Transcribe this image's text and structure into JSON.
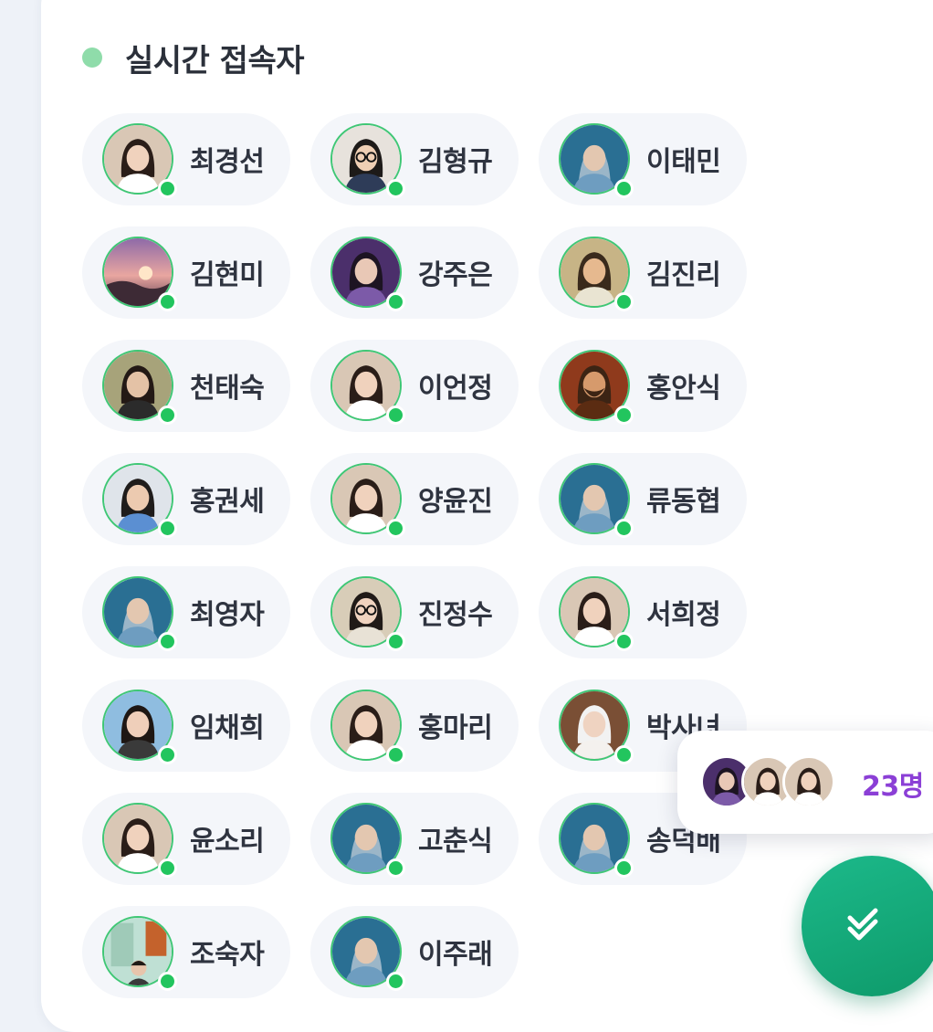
{
  "panel": {
    "title": "실시간 접속자",
    "live_indicator_color": "#8fdcaa"
  },
  "users": [
    {
      "name": "최경선",
      "online": true,
      "avatar": "woman-portrait"
    },
    {
      "name": "김형규",
      "online": true,
      "avatar": "man-glasses"
    },
    {
      "name": "이태민",
      "online": true,
      "avatar": "hooded-figure"
    },
    {
      "name": "김현미",
      "online": true,
      "avatar": "sunset-landscape"
    },
    {
      "name": "강주은",
      "online": true,
      "avatar": "woman-purple"
    },
    {
      "name": "김진리",
      "online": true,
      "avatar": "child-portrait"
    },
    {
      "name": "천태숙",
      "online": true,
      "avatar": "woman-outdoor"
    },
    {
      "name": "이언정",
      "online": true,
      "avatar": "woman-portrait"
    },
    {
      "name": "홍안식",
      "online": true,
      "avatar": "laughing-man"
    },
    {
      "name": "홍권세",
      "online": true,
      "avatar": "man-blue-shirt"
    },
    {
      "name": "양윤진",
      "online": true,
      "avatar": "woman-portrait"
    },
    {
      "name": "류동협",
      "online": true,
      "avatar": "hooded-figure"
    },
    {
      "name": "최영자",
      "online": true,
      "avatar": "hooded-figure"
    },
    {
      "name": "진정수",
      "online": true,
      "avatar": "woman-glasses"
    },
    {
      "name": "서희정",
      "online": true,
      "avatar": "woman-portrait"
    },
    {
      "name": "임채희",
      "online": true,
      "avatar": "woman-city"
    },
    {
      "name": "홍마리",
      "online": true,
      "avatar": "woman-portrait"
    },
    {
      "name": "박사녀",
      "online": true,
      "avatar": "baby-photo"
    },
    {
      "name": "윤소리",
      "online": true,
      "avatar": "woman-portrait"
    },
    {
      "name": "고춘식",
      "online": true,
      "avatar": "hooded-figure"
    },
    {
      "name": "송덕배",
      "online": true,
      "avatar": "hooded-figure"
    },
    {
      "name": "조숙자",
      "online": true,
      "avatar": "outdoor-scene"
    },
    {
      "name": "이주래",
      "online": true,
      "avatar": "hooded-figure"
    }
  ],
  "summary": {
    "count_label": "23명",
    "count": 23,
    "count_color": "#8b3fd6",
    "preview_avatars": [
      "woman-purple",
      "woman-portrait",
      "woman-portrait"
    ]
  },
  "fab": {
    "icon": "double-check-icon",
    "color": "#14a878"
  },
  "status_color": "#22c55e"
}
